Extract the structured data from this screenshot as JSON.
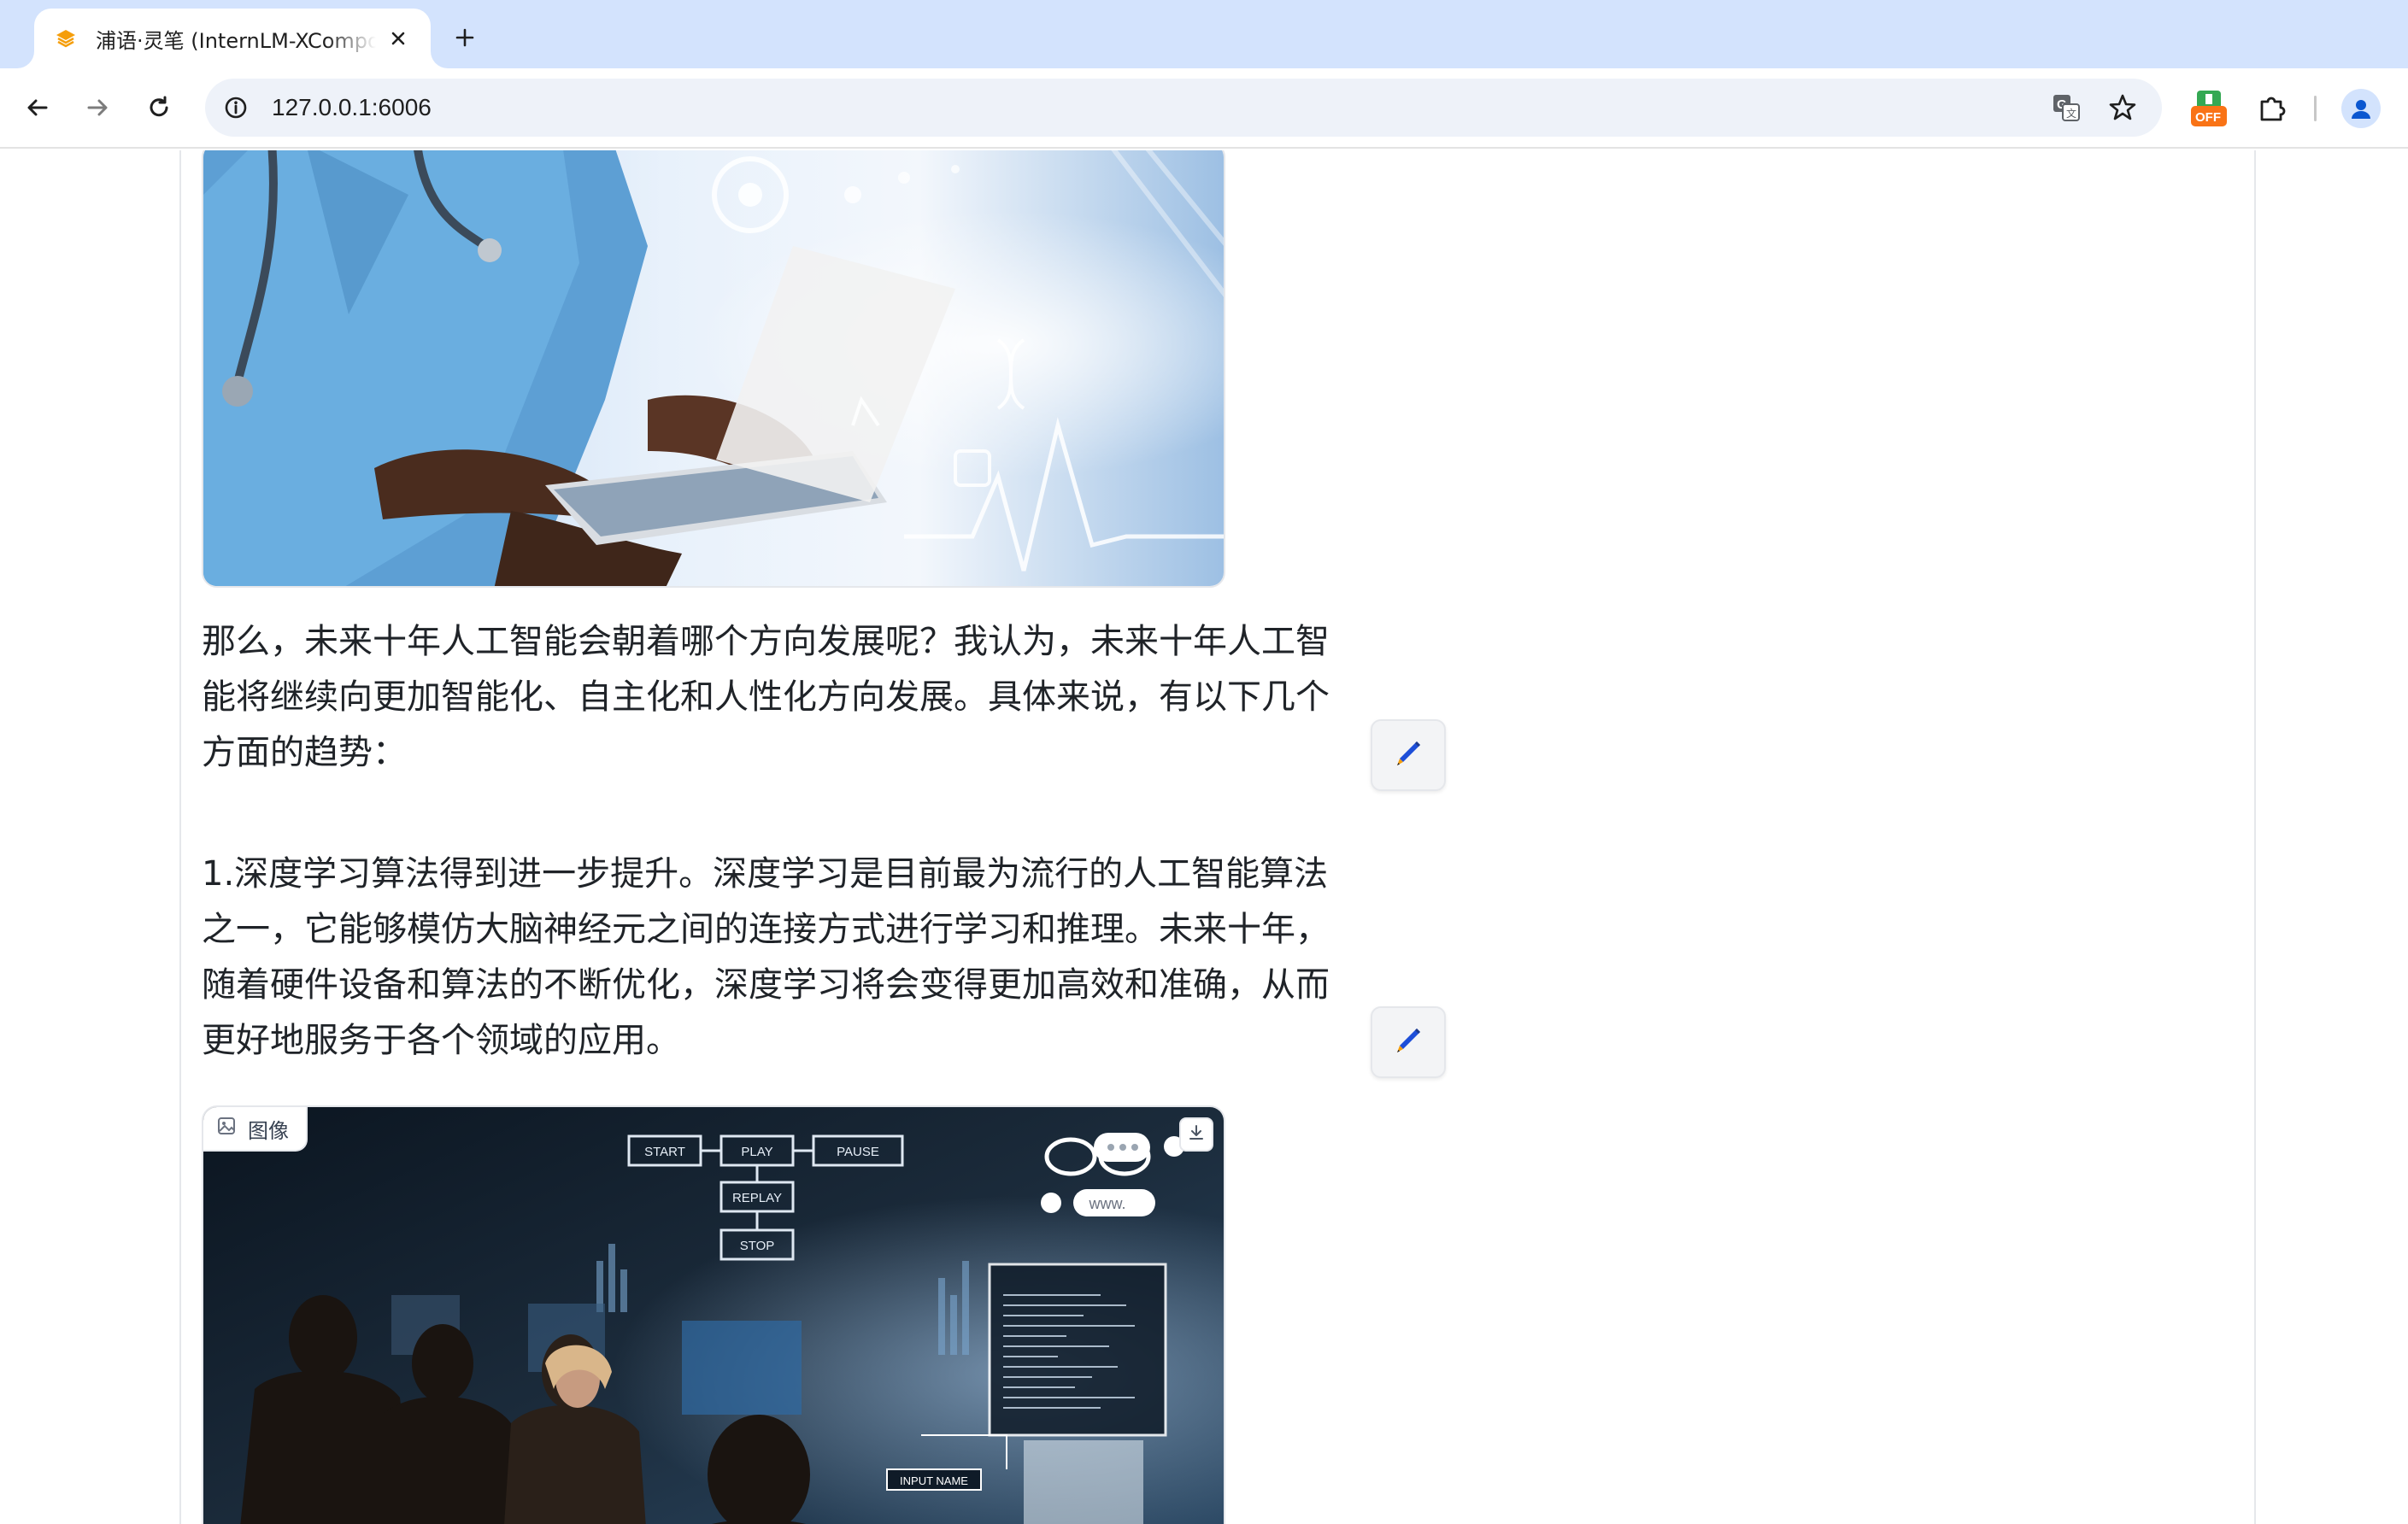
{
  "browser": {
    "tab": {
      "title": "浦语·灵笔 (InternLM-XComposer)",
      "favicon": "internlm-logo-icon"
    },
    "new_tab_icon": "plus-icon",
    "url": "127.0.0.1:6006",
    "toolbar_icons": [
      "back-arrow-icon",
      "forward-arrow-icon",
      "reload-icon",
      "site-info-icon",
      "translate-icon",
      "bookmark-star-icon",
      "extension-off-icon",
      "extensions-puzzle-icon",
      "profile-avatar-icon"
    ],
    "extension_badge": "OFF"
  },
  "chat": {
    "paragraph_1": "那么，未来十年人工智能会朝着哪个方向发展呢？我认为，未来十年人工智能将继续向更加智能化、自主化和人性化方向发展。具体来说，有以下几个方面的趋势：",
    "paragraph_2": "1.深度学习算法得到进一步提升。深度学习是目前最为流行的人工智能算法之一，它能够模仿大脑神经元之间的连接方式进行学习和推理。未来十年，随着硬件设备和算法的不断优化，深度学习将会变得更加高效和准确，从而更好地服务于各个领域的应用。",
    "image_label": "图像",
    "edit_icon": "pencil-edit-icon",
    "download_icon": "download-icon",
    "image_2_text": {
      "start": "START",
      "play": "PLAY",
      "pause": "PAUSE",
      "replay": "REPLAY",
      "stop": "STOP",
      "www": "www.",
      "input_name": "INPUT NAME"
    }
  },
  "colors": {
    "tabstrip": "#d3e3fd",
    "omnibox": "#eef2f9",
    "accent": "#f59e0b",
    "pencil": "#1d4ed8"
  }
}
